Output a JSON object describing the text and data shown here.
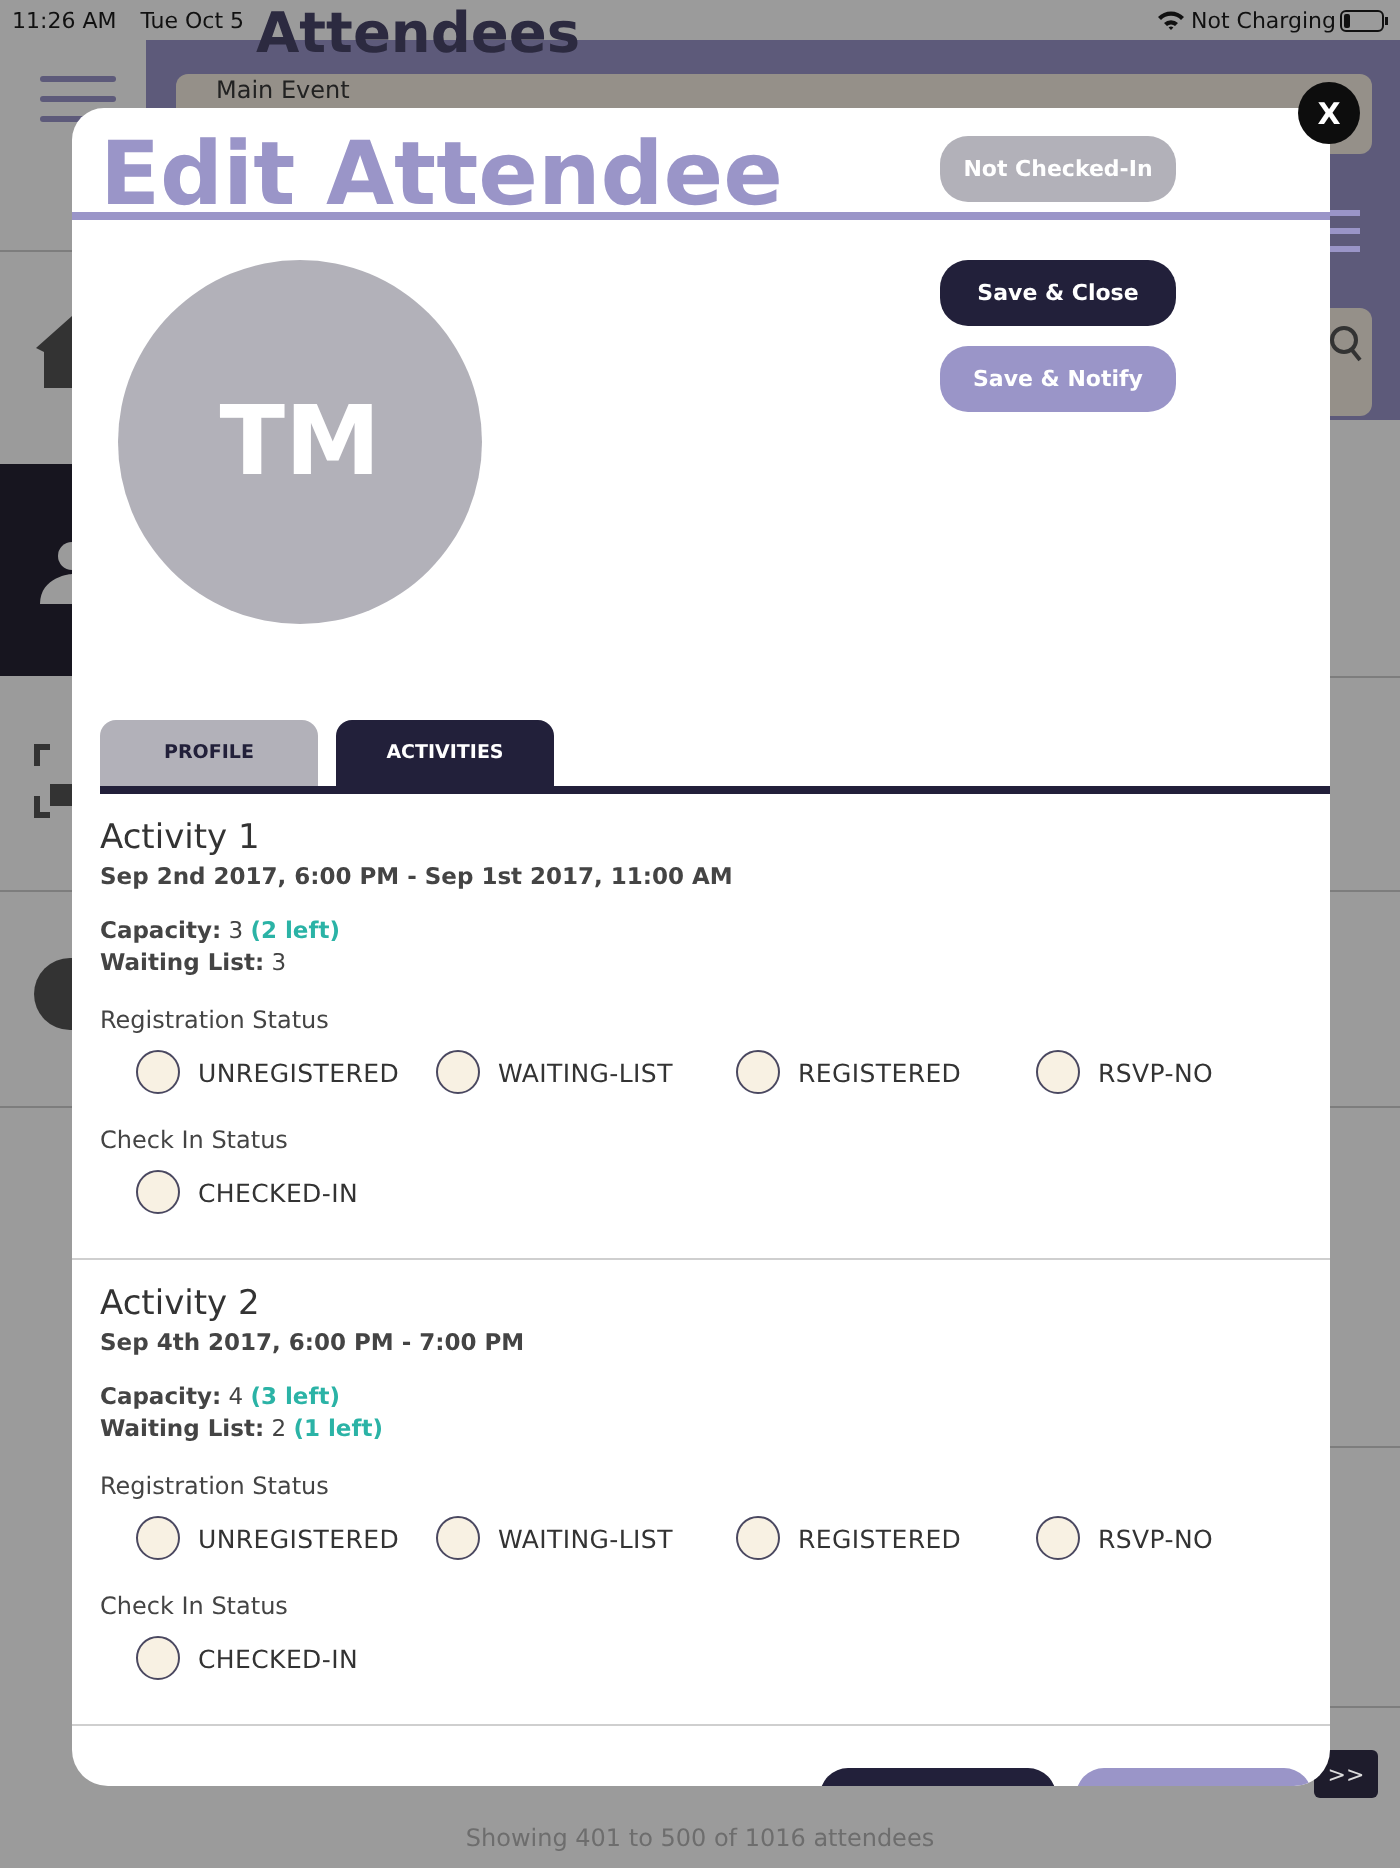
{
  "status_bar": {
    "time": "11:26 AM",
    "date": "Tue Oct 5",
    "battery_text": "Not Charging"
  },
  "background": {
    "title": "Attendees",
    "event_field": "Main Event",
    "footer": "Showing 401 to 500 of 1016 attendees",
    "next_button": ">>"
  },
  "modal": {
    "title": "Edit Attendee",
    "close": "X",
    "check_in_badge": "Not Checked-In",
    "buttons": [
      {
        "label": "Save & Close",
        "kind": "primary"
      },
      {
        "label": "Save & Notify",
        "kind": "secondary"
      }
    ],
    "avatar_initials": "TM",
    "tabs": [
      {
        "label": "PROFILE",
        "selected": false
      },
      {
        "label": "ACTIVITIES",
        "selected": true
      }
    ],
    "activities": [
      {
        "name": "Activity 1",
        "dates": "Sep 2nd 2017, 6:00 PM - Sep 1st 2017, 11:00 AM",
        "capacity": {
          "label": "Capacity:",
          "value": "3",
          "remaining": "(2 left)"
        },
        "waiting_list": {
          "label": "Waiting List:",
          "value": "3"
        },
        "registration_label": "Registration Status",
        "registration_options": [
          {
            "label": "UNREGISTERED",
            "selected": false
          },
          {
            "label": "WAITING-LIST",
            "selected": false
          },
          {
            "label": "REGISTERED",
            "selected": false
          },
          {
            "label": "RSVP-NO",
            "selected": false
          }
        ],
        "check_in_label": "Check In Status",
        "check_in_options": [
          {
            "label": "CHECKED-IN",
            "checked": false
          }
        ]
      },
      {
        "name": "Activity 2",
        "dates": "Sep 4th 2017, 6:00 PM - 7:00 PM",
        "capacity": {
          "label": "Capacity:",
          "value": "4",
          "remaining": "(3 left)"
        },
        "waiting_list": {
          "label": "Waiting List:",
          "value": "2",
          "remaining": "(1 left)"
        },
        "registration_label": "Registration Status",
        "registration_options": [
          {
            "label": "UNREGISTERED",
            "selected": false
          },
          {
            "label": "WAITING-LIST",
            "selected": false
          },
          {
            "label": "REGISTERED",
            "selected": false
          },
          {
            "label": "RSVP-NO",
            "selected": false
          }
        ],
        "check_in_label": "Check In Status",
        "check_in_options": [
          {
            "label": "CHECKED-IN",
            "checked": false
          }
        ]
      }
    ]
  }
}
